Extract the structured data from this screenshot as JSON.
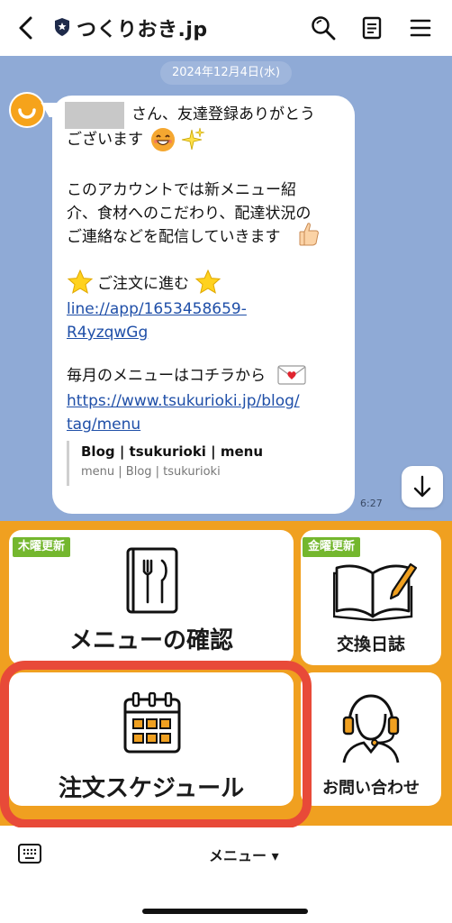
{
  "header": {
    "title": "つくりおき.jp"
  },
  "chat": {
    "date": "2024年12月4日(水)",
    "message": {
      "line1": "さん、友達登録ありがとう",
      "line2": "ございます",
      "line3": "このアカウントでは新メニュー紹",
      "line4": "介、食材へのこだわり、配達状況の",
      "line5": "ご連絡などを配信していきます",
      "order_label": "ご注文に進む",
      "order_link_1": "line://app/1653458659-",
      "order_link_2": "R4yzqwGg",
      "menu_text": "毎月のメニューはコチラから",
      "menu_link_1": "https://www.tsukurioki.jp/blog/",
      "menu_link_2": "tag/menu",
      "preview_title": "Blog | tsukurioki | menu",
      "preview_sub": "menu | Blog | tsukurioki",
      "time": "6:27"
    }
  },
  "richmenu": {
    "menu_confirm": {
      "tag": "木曜更新",
      "label": "メニューの確認"
    },
    "exchange_diary": {
      "tag": "金曜更新",
      "label": "交換日誌"
    },
    "order_schedule": {
      "label": "注文スケジュール"
    },
    "contact": {
      "label": "お問い合わせ"
    }
  },
  "bottombar": {
    "menu_label": "メニュー ▾"
  },
  "colors": {
    "chat_bg": "#8faad6",
    "richmenu_bg": "#f0a020",
    "tag_green": "#74b72e",
    "highlight_red": "#e84a38",
    "link_blue": "#1f4fa8"
  },
  "icons": [
    "back-icon",
    "shield-icon",
    "search-icon",
    "note-icon",
    "hamburger-icon",
    "avatar-icon",
    "grin-emoji",
    "sparkle-emoji",
    "thumbs-up-emoji",
    "star-emoji",
    "envelope-emoji",
    "chevron-down-icon",
    "menu-book-icon",
    "open-book-icon",
    "calendar-icon",
    "headset-icon",
    "keyboard-icon"
  ]
}
